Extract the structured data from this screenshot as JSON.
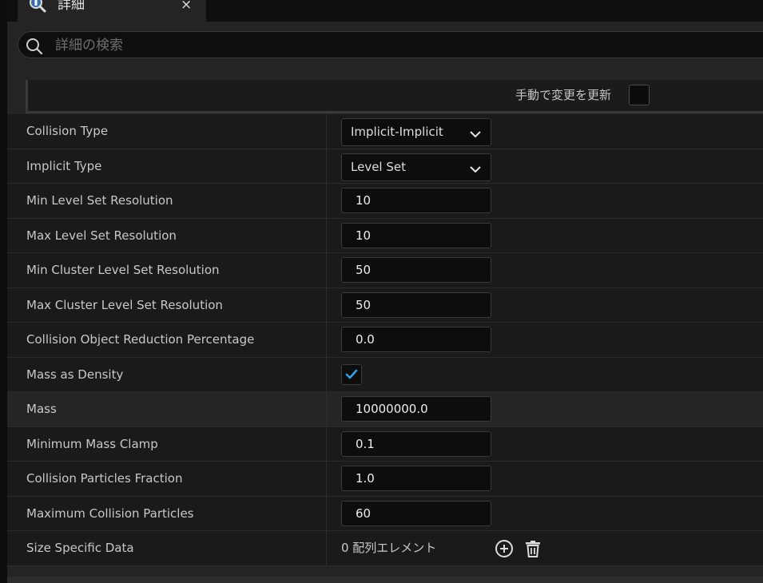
{
  "tab": {
    "title": "詳細",
    "close": "×"
  },
  "search": {
    "placeholder": "詳細の検索"
  },
  "header": {
    "manual_update_label": "手動で変更を更新",
    "manual_update_checked": false
  },
  "properties": [
    {
      "label": "Collision Type",
      "type": "dropdown",
      "value": "Implicit-Implicit"
    },
    {
      "label": "Implicit Type",
      "type": "dropdown",
      "value": "Level Set"
    },
    {
      "label": "Min Level Set Resolution",
      "type": "number",
      "value": "10"
    },
    {
      "label": "Max Level Set Resolution",
      "type": "number",
      "value": "10"
    },
    {
      "label": "Min Cluster Level Set Resolution",
      "type": "number",
      "value": "50"
    },
    {
      "label": "Max Cluster Level Set Resolution",
      "type": "number",
      "value": "50"
    },
    {
      "label": "Collision Object Reduction Percentage",
      "type": "number",
      "value": "0.0"
    },
    {
      "label": "Mass as Density",
      "type": "checkbox",
      "checked": true
    },
    {
      "label": "Mass",
      "type": "number",
      "value": "10000000.0",
      "highlighted": true
    },
    {
      "label": "Minimum Mass Clamp",
      "type": "number",
      "value": "0.1"
    },
    {
      "label": "Collision Particles Fraction",
      "type": "number",
      "value": "1.0"
    },
    {
      "label": "Maximum Collision Particles",
      "type": "number",
      "value": "60"
    },
    {
      "label": "Size Specific Data",
      "type": "array",
      "value": "0 配列エレメント"
    }
  ],
  "icons": {
    "tab": "details-magnifier-icon",
    "search": "search-icon",
    "dropdown": "chevron-down-icon",
    "check": "checkmark-icon",
    "add": "add-element-icon",
    "delete": "trash-icon"
  },
  "colors": {
    "checkmark": "#3a9ee0"
  }
}
